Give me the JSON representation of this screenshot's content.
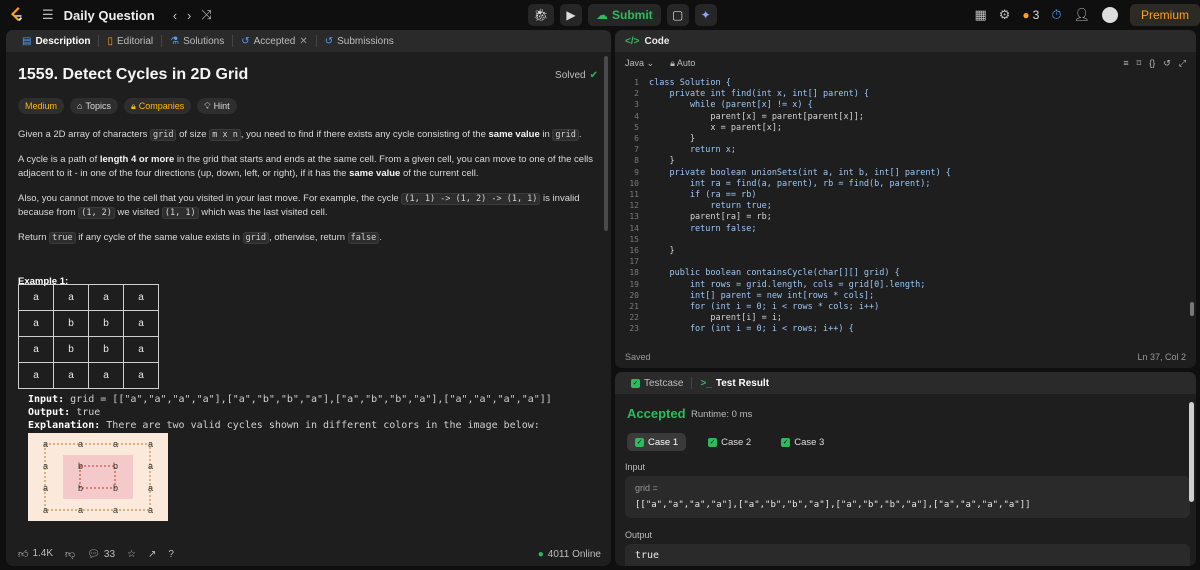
{
  "topbar": {
    "list_label": "Daily Question",
    "submit_label": "Submit",
    "streak": "3",
    "premium_label": "Premium"
  },
  "left_tabs": [
    {
      "label": "Description"
    },
    {
      "label": "Editorial"
    },
    {
      "label": "Solutions"
    },
    {
      "label": "Accepted"
    },
    {
      "label": "Submissions"
    }
  ],
  "problem": {
    "title": "1559. Detect Cycles in 2D Grid",
    "status": "Solved",
    "difficulty": "Medium",
    "topics_label": "Topics",
    "companies_label": "Companies",
    "hint_label": "Hint"
  },
  "example": {
    "heading": "Example 1:",
    "grid": [
      [
        "a",
        "a",
        "a",
        "a"
      ],
      [
        "a",
        "b",
        "b",
        "a"
      ],
      [
        "a",
        "b",
        "b",
        "a"
      ],
      [
        "a",
        "a",
        "a",
        "a"
      ]
    ],
    "input_label": "Input:",
    "input_value": "grid = [[\"a\",\"a\",\"a\",\"a\"],[\"a\",\"b\",\"b\",\"a\"],[\"a\",\"b\",\"b\",\"a\"],[\"a\",\"a\",\"a\",\"a\"]]",
    "output_label": "Output:",
    "output_value": "true",
    "explanation_label": "Explanation:",
    "explanation_value": "There are two valid cycles shown in different colors in the image below:"
  },
  "footer": {
    "likes": "1.4K",
    "comments": "33",
    "online": "4011 Online"
  },
  "code_panel": {
    "title": "Code",
    "language": "Java",
    "autosave": "Auto",
    "saved": "Saved",
    "cursor": "Ln 37, Col 2",
    "line_numbers": [
      "1",
      "2",
      "3",
      "4",
      "5",
      "6",
      "7",
      "8",
      "9",
      "10",
      "11",
      "12",
      "13",
      "14",
      "15",
      "16",
      "17",
      "18",
      "19",
      "20",
      "21",
      "22",
      "23"
    ],
    "lines": [
      "class Solution {",
      "    private int find(int x, int[] parent) {",
      "        while (parent[x] != x) {",
      "            parent[x] = parent[parent[x]];",
      "            x = parent[x];",
      "        }",
      "        return x;",
      "    }",
      "    private boolean unionSets(int a, int b, int[] parent) {",
      "        int ra = find(a, parent), rb = find(b, parent);",
      "        if (ra == rb)",
      "            return true;",
      "        parent[ra] = rb;",
      "        return false;",
      "",
      "    }",
      "",
      "    public boolean containsCycle(char[][] grid) {",
      "        int rows = grid.length, cols = grid[0].length;",
      "        int[] parent = new int[rows * cols];",
      "        for (int i = 0; i < rows * cols; i++)",
      "            parent[i] = i;",
      "        for (int i = 0; i < rows; i++) {"
    ]
  },
  "test_panel": {
    "testcase_tab": "Testcase",
    "result_tab": "Test Result",
    "verdict": "Accepted",
    "runtime": "Runtime: 0 ms",
    "cases": [
      "Case 1",
      "Case 2",
      "Case 3"
    ],
    "input_label": "Input",
    "var_name": "grid =",
    "input_value": "[[\"a\",\"a\",\"a\",\"a\"],[\"a\",\"b\",\"b\",\"a\"],[\"a\",\"b\",\"b\",\"a\"],[\"a\",\"a\",\"a\",\"a\"]]",
    "output_label": "Output",
    "output_value": "true"
  },
  "colors": {
    "accent": "#ffa116",
    "success": "#2cbb5d",
    "medium": "#ffb800",
    "link": "#3b82f6"
  }
}
